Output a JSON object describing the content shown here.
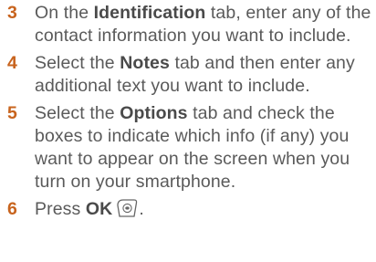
{
  "steps": [
    {
      "number": "3",
      "pre": "On the ",
      "bold": "Identification",
      "post": " tab, enter any of the contact information you want to include."
    },
    {
      "number": "4",
      "pre": "Select the ",
      "bold": "Notes",
      "post": " tab and then enter any additional text you want to include."
    },
    {
      "number": "5",
      "pre": "Select the ",
      "bold": "Options",
      "post": " tab and check the boxes to indicate which info (if any) you want to appear on the screen when you turn on your smartphone."
    },
    {
      "number": "6",
      "pre": "Press ",
      "bold": "OK",
      "post": "."
    }
  ],
  "icons": {
    "ok_key": "ok-key-icon"
  },
  "colors": {
    "step_number": "#c8641e",
    "body_text": "#5a5a5a"
  }
}
